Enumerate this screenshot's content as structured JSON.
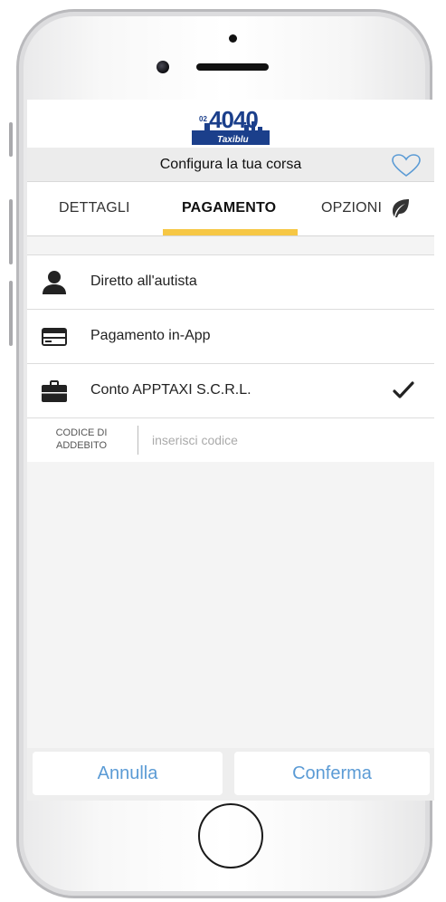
{
  "header": {
    "logo_prefix": "02",
    "logo_number": "4040",
    "logo_brand": "Taxiblu",
    "title": "Configura la tua corsa"
  },
  "tabs": [
    {
      "label": "DETTAGLI",
      "active": false
    },
    {
      "label": "PAGAMENTO",
      "active": true
    },
    {
      "label": "OPZIONI",
      "active": false
    }
  ],
  "payment_options": [
    {
      "label": "Diretto all'autista",
      "icon": "person-icon",
      "selected": false
    },
    {
      "label": "Pagamento in-App",
      "icon": "credit-card-icon",
      "selected": false
    },
    {
      "label": "Conto APPTAXI S.C.R.L.",
      "icon": "briefcase-icon",
      "selected": true
    }
  ],
  "billing_code": {
    "label_line1": "CODICE DI",
    "label_line2": "ADDEBITO",
    "placeholder": "inserisci codice",
    "value": ""
  },
  "actions": {
    "cancel_label": "Annulla",
    "confirm_label": "Conferma"
  },
  "colors": {
    "accent_tab": "#f6c744",
    "button_text": "#5b9bd5",
    "heart": "#5b9bd5",
    "logo_blue": "#1b3f8b"
  }
}
